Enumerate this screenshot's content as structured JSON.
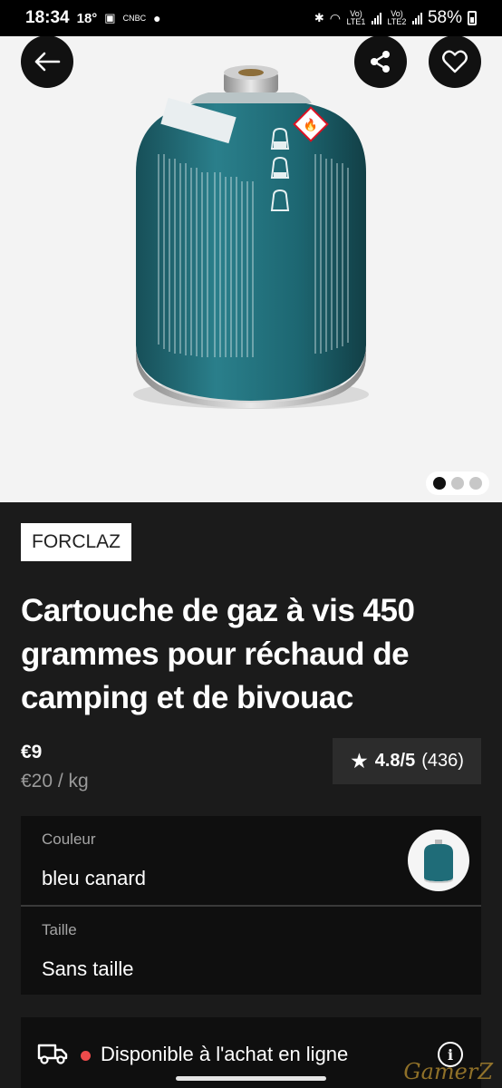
{
  "status_bar": {
    "time": "18:34",
    "temperature": "18°",
    "network_small": "CNBC",
    "sim1_label": "Vo) LTE1",
    "sim2_label": "Vo) LTE2",
    "battery": "58%"
  },
  "hero": {
    "image_alt": "Cartouche de gaz bleu canard",
    "carousel_pages": 3,
    "active_page": 1
  },
  "product": {
    "brand": "FORCLAZ",
    "title": "Cartouche de gaz à vis 450 grammes pour réchaud de camping et de bivouac",
    "price": "€9",
    "unit_price": "€20 / kg",
    "rating_value": "4.8/5",
    "rating_count": "(436)"
  },
  "variants": {
    "color_label": "Couleur",
    "color_value": "bleu canard",
    "size_label": "Taille",
    "size_value": "Sans taille"
  },
  "availability": {
    "text": "Disponible à l'achat en ligne",
    "status_color": "#ef4b4b"
  },
  "watermark": "GamerZ",
  "colors": {
    "canister": "#1f6c78",
    "background_dark": "#1b1b1b"
  }
}
